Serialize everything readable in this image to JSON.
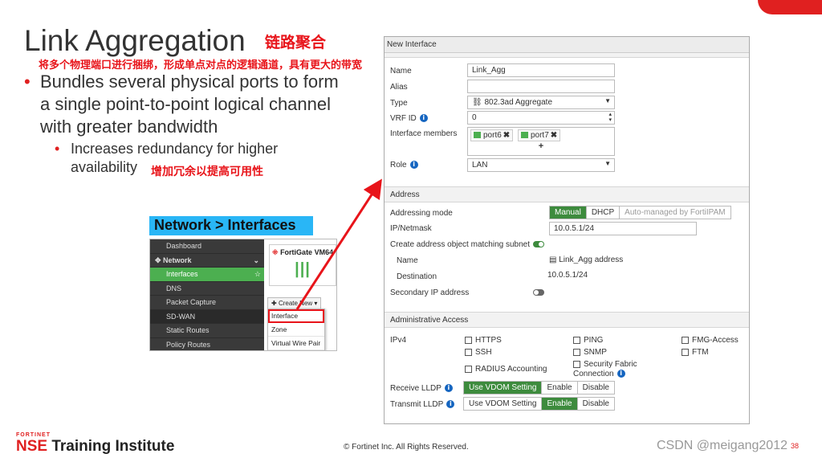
{
  "slide": {
    "title": "Link Aggregation",
    "title_cn": "链路聚合",
    "sub_cn": "将多个物理端口进行捆绑，形成单点对点的逻辑通道，具有更大的带宽",
    "bullet1": "Bundles several physical ports to form a single point-to-point logical channel with greater bandwidth",
    "bullet2": "Increases redundancy for higher availability",
    "bullet2_cn": "增加冗余以提高可用性",
    "nav_path": "Network > Interfaces",
    "copyright": "© Fortinet Inc. All Rights Reserved.",
    "brand_small": "FORTINET",
    "brand_nse": "NSE",
    "brand_rest": " Training Institute",
    "watermark": "CSDN @meigang2012",
    "page_number": "38"
  },
  "mini_nav": {
    "items": [
      "Dashboard",
      "Network",
      "Interfaces",
      "DNS",
      "Packet Capture",
      "SD-WAN",
      "Static Routes",
      "Policy Routes"
    ],
    "device": "FortiGate VM64",
    "create_new": "Create New",
    "menu": [
      "Interface",
      "Zone",
      "Virtual Wire Pair"
    ]
  },
  "dialog": {
    "title": "New Interface",
    "labels": {
      "name": "Name",
      "alias": "Alias",
      "type": "Type",
      "vrf": "VRF ID",
      "members": "Interface members",
      "role": "Role"
    },
    "values": {
      "name": "Link_Agg",
      "alias": "",
      "type": "802.3ad Aggregate",
      "vrf": "0",
      "role": "LAN"
    },
    "members": [
      "port6",
      "port7"
    ],
    "add_symbol": "+",
    "address": {
      "section": "Address",
      "mode_label": "Addressing mode",
      "modes": [
        "Manual",
        "DHCP",
        "Auto-managed by FortiIPAM"
      ],
      "ip_label": "IP/Netmask",
      "ip_value": "10.0.5.1/24",
      "create_obj_label": "Create address object matching subnet",
      "obj_name_label": "Name",
      "obj_name_value": "Link_Agg address",
      "dest_label": "Destination",
      "dest_value": "10.0.5.1/24",
      "secondary_label": "Secondary IP address"
    },
    "admin": {
      "section": "Administrative Access",
      "ipv4_label": "IPv4",
      "col1": [
        "HTTPS",
        "SSH",
        "RADIUS Accounting"
      ],
      "col2": [
        "PING",
        "SNMP",
        "Security Fabric Connection"
      ],
      "col3": [
        "FMG-Access",
        "FTM"
      ],
      "receive_label": "Receive LLDP",
      "transmit_label": "Transmit LLDP",
      "lldp_options": [
        "Use VDOM Setting",
        "Enable",
        "Disable"
      ]
    }
  },
  "colors": {
    "accent_red": "#e8141a",
    "fortinet_green": "#3d8b3d",
    "nav_blue": "#29b6f6"
  }
}
